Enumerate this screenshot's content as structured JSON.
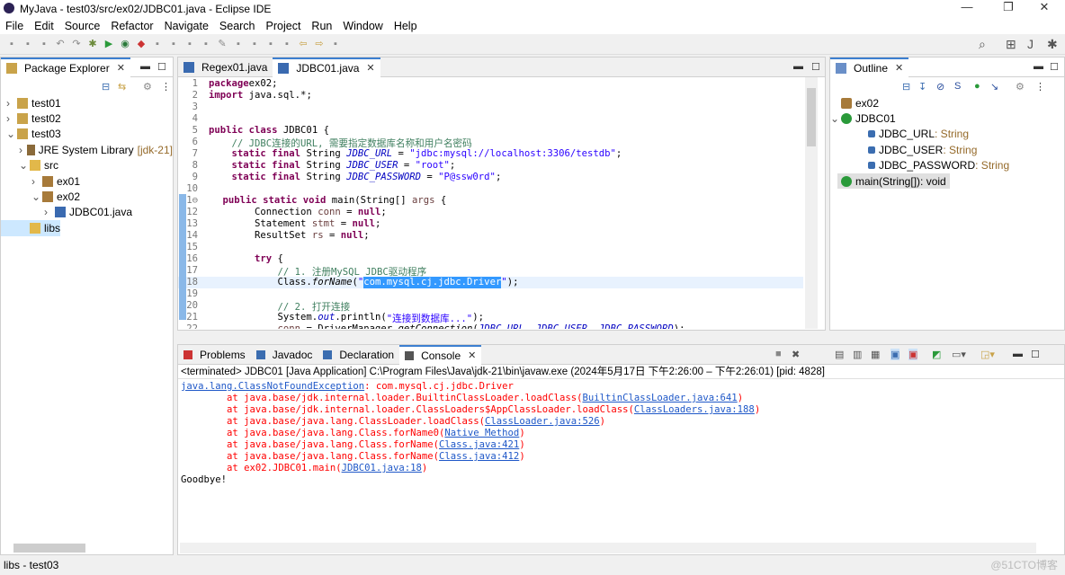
{
  "window": {
    "title": "MyJava - test03/src/ex02/JDBC01.java - Eclipse IDE",
    "min": "—",
    "max": "❐",
    "close": "✕"
  },
  "menu": [
    "File",
    "Edit",
    "Source",
    "Refactor",
    "Navigate",
    "Search",
    "Project",
    "Run",
    "Window",
    "Help"
  ],
  "package_explorer": {
    "title": "Package Explorer",
    "items": [
      {
        "label": "test01",
        "depth": 0,
        "arrow": "›",
        "icon": "project"
      },
      {
        "label": "test02",
        "depth": 0,
        "arrow": "›",
        "icon": "project"
      },
      {
        "label": "test03",
        "depth": 0,
        "arrow": "⌄",
        "icon": "project"
      },
      {
        "label": "JRE System Library",
        "extra": "[jdk-21]",
        "depth": 1,
        "arrow": "›",
        "icon": "library"
      },
      {
        "label": "src",
        "depth": 1,
        "arrow": "⌄",
        "icon": "folder"
      },
      {
        "label": "ex01",
        "depth": 2,
        "arrow": "›",
        "icon": "package"
      },
      {
        "label": "ex02",
        "depth": 2,
        "arrow": "⌄",
        "icon": "package"
      },
      {
        "label": "JDBC01.java",
        "depth": 3,
        "arrow": "›",
        "icon": "java-file"
      },
      {
        "label": "libs",
        "depth": 1,
        "arrow": "",
        "icon": "folder",
        "selected": true
      }
    ]
  },
  "editor": {
    "tabs": [
      {
        "label": "Regex01.java",
        "active": false
      },
      {
        "label": "JDBC01.java",
        "active": true
      }
    ],
    "lines": [
      [
        [
          "kw",
          "package"
        ],
        [
          "",
          "ex02;"
        ]
      ],
      [
        [
          "kw",
          "import"
        ],
        [
          "",
          " java.sql.*;"
        ]
      ],
      [],
      [],
      [
        [
          "kw",
          "public class"
        ],
        [
          "",
          " JDBC01 {"
        ]
      ],
      [
        [
          "",
          "    "
        ],
        [
          "cm",
          "// JDBC连接的URL, 需要指定数据库名称和用户名密码"
        ]
      ],
      [
        [
          "",
          "    "
        ],
        [
          "kw",
          "static final"
        ],
        [
          "",
          " String "
        ],
        [
          "fi",
          "JDBC_URL"
        ],
        [
          "",
          " = "
        ],
        [
          "st",
          "\"jdbc:mysql://localhost:3306/testdb\""
        ],
        [
          "",
          ";"
        ]
      ],
      [
        [
          "",
          "    "
        ],
        [
          "kw",
          "static final"
        ],
        [
          "",
          " String "
        ],
        [
          "fi",
          "JDBC_USER"
        ],
        [
          "",
          " = "
        ],
        [
          "st",
          "\"root\""
        ],
        [
          "",
          ";"
        ]
      ],
      [
        [
          "",
          "    "
        ],
        [
          "kw",
          "static final"
        ],
        [
          "",
          " String "
        ],
        [
          "fi",
          "JDBC_PASSWORD"
        ],
        [
          "",
          " = "
        ],
        [
          "st",
          "\"P@ssw0rd\""
        ],
        [
          "",
          ";"
        ]
      ],
      [],
      [
        [
          "",
          "    "
        ],
        [
          "kw",
          "public static void"
        ],
        [
          "",
          " main(String[] "
        ],
        [
          "var",
          "args"
        ],
        [
          "",
          " {"
        ]
      ],
      [
        [
          "",
          "        Connection "
        ],
        [
          "var",
          "conn"
        ],
        [
          "",
          " = "
        ],
        [
          "kw",
          "null"
        ],
        [
          "",
          ";"
        ]
      ],
      [
        [
          "",
          "        Statement "
        ],
        [
          "var",
          "stmt"
        ],
        [
          "",
          " = "
        ],
        [
          "kw",
          "null"
        ],
        [
          "",
          ";"
        ]
      ],
      [
        [
          "",
          "        ResultSet "
        ],
        [
          "var",
          "rs"
        ],
        [
          "",
          " = "
        ],
        [
          "kw",
          "null"
        ],
        [
          "",
          ";"
        ]
      ],
      [],
      [
        [
          "",
          "        "
        ],
        [
          "kw",
          "try"
        ],
        [
          "",
          " {"
        ]
      ],
      [
        [
          "",
          "            "
        ],
        [
          "cm",
          "// 1. 注册MySQL JDBC驱动程序"
        ]
      ],
      [
        [
          "",
          "            Class."
        ],
        [
          "it",
          "forName"
        ],
        [
          "",
          "("
        ],
        [
          "st",
          "\""
        ],
        [
          "sel",
          "com.mysql.cj.jdbc.Driver"
        ],
        [
          "st",
          "\""
        ],
        [
          "",
          ");"
        ]
      ],
      [],
      [
        [
          "",
          "            "
        ],
        [
          "cm",
          "// 2. 打开连接"
        ]
      ],
      [
        [
          "",
          "            System."
        ],
        [
          "fi",
          "out"
        ],
        [
          "",
          ".println("
        ],
        [
          "st",
          "\"连接到数据库...\""
        ],
        [
          "",
          ");"
        ]
      ],
      [
        [
          "",
          "            "
        ],
        [
          "var",
          "conn"
        ],
        [
          "",
          " = DriverManager."
        ],
        [
          "it",
          "getConnection"
        ],
        [
          "",
          "("
        ],
        [
          "fi",
          "JDBC_URL"
        ],
        [
          "",
          ", "
        ],
        [
          "fi",
          "JDBC_USER"
        ],
        [
          "",
          ", "
        ],
        [
          "fi",
          "JDBC_PASSWORD"
        ],
        [
          "",
          ");"
        ]
      ]
    ]
  },
  "outline": {
    "title": "Outline",
    "items": [
      {
        "label": "ex02",
        "type": "",
        "depth": 0
      },
      {
        "label": "JDBC01",
        "type": "",
        "depth": 0
      },
      {
        "label": "JDBC_URL",
        "type": " : String",
        "depth": 1
      },
      {
        "label": "JDBC_USER",
        "type": " : String",
        "depth": 1
      },
      {
        "label": "JDBC_PASSWORD",
        "type": " : String",
        "depth": 1
      },
      {
        "label": "main(String[])",
        "type": " : void",
        "depth": 1,
        "selected": true
      }
    ]
  },
  "console": {
    "tabs": [
      "Problems",
      "Javadoc",
      "Declaration",
      "Console"
    ],
    "status": "<terminated> JDBC01 [Java Application] C:\\Program Files\\Java\\jdk-21\\bin\\javaw.exe  (2024年5月17日 下午2:26:00 – 下午2:26:01) [pid: 4828]",
    "exception": {
      "link": "java.lang.ClassNotFoundException",
      "msg": ": com.mysql.cj.jdbc.Driver"
    },
    "trace": [
      {
        "text": "        at java.base/jdk.internal.loader.BuiltinClassLoader.loadClass(",
        "link": "BuiltinClassLoader.java:641"
      },
      {
        "text": "        at java.base/jdk.internal.loader.ClassLoaders$AppClassLoader.loadClass(",
        "link": "ClassLoaders.java:188"
      },
      {
        "text": "        at java.base/java.lang.ClassLoader.loadClass(",
        "link": "ClassLoader.java:526"
      },
      {
        "text": "        at java.base/java.lang.Class.forName0(",
        "link": "Native Method"
      },
      {
        "text": "        at java.base/java.lang.Class.forName(",
        "link": "Class.java:421"
      },
      {
        "text": "        at java.base/java.lang.Class.forName(",
        "link": "Class.java:412"
      },
      {
        "text": "        at ex02.JDBC01.main(",
        "link": "JDBC01.java:18"
      }
    ],
    "last": "Goodbye!"
  },
  "statusbar": {
    "text": "libs - test03"
  },
  "watermark": "@51CTO博客"
}
